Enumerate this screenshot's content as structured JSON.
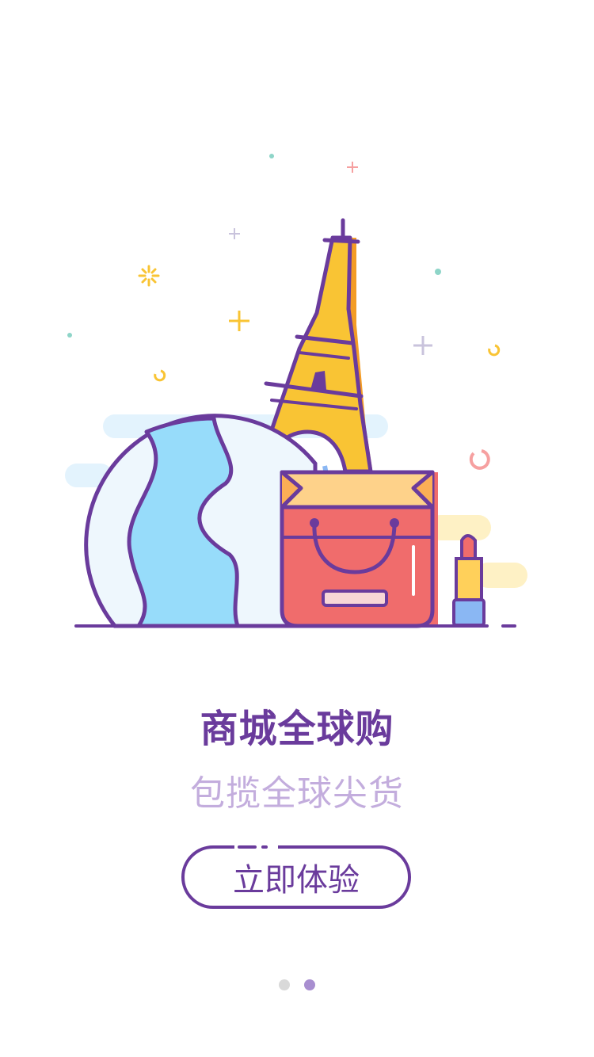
{
  "slide": {
    "title": "商城全球购",
    "subtitle": "包揽全球尖货",
    "cta_label": "立即体验",
    "current_page": 2,
    "total_pages": 2
  },
  "colors": {
    "primary": "#6a3b9c",
    "subtitle": "#c3addd",
    "dot_inactive": "#d9d9d9",
    "dot_active": "#a88ed0",
    "globe_water": "#97dcfa",
    "globe_land": "#eef7fd",
    "tower": "#f9c434",
    "tower_shadow": "#f39c26",
    "bag": "#f06c6c",
    "bag_top": "#fed28a",
    "lipstick_body": "#ffd05a",
    "lipstick_base": "#8ab7f3",
    "cloud_blue": "#e3f3fd",
    "cloud_yellow": "#fef1c5"
  },
  "illustration": {
    "icons": [
      "eiffel-tower-icon",
      "globe-icon",
      "shopping-bag-icon",
      "lipstick-icon"
    ]
  }
}
